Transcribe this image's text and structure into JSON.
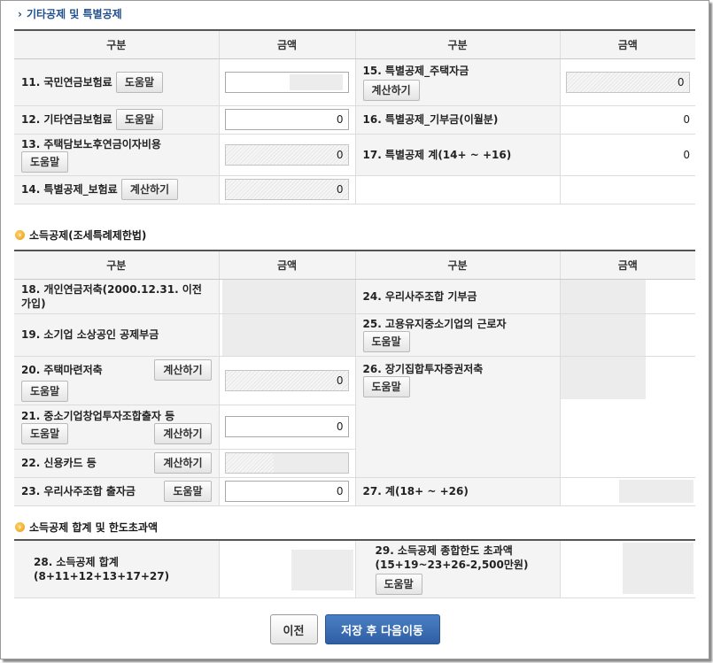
{
  "sections": {
    "other": "기타공제 및 특별공제",
    "income": "소득공제(조세특례제한법)",
    "total": "소득공제 합계 및 한도초과액"
  },
  "headers": {
    "category": "구분",
    "amount": "금액"
  },
  "buttons": {
    "help": "도움말",
    "calc": "계산하기",
    "prev": "이전",
    "save_next": "저장 후 다음이동"
  },
  "table1": {
    "r11": {
      "label": "11. 국민연금보험료"
    },
    "r12": {
      "label": "12. 기타연금보험료",
      "value": "0"
    },
    "r13": {
      "label": "13. 주택담보노후연금이자비용",
      "value": "0"
    },
    "r14": {
      "label": "14. 특별공제_보험료",
      "value": "0"
    },
    "r15": {
      "label": "15. 특별공제_주택자금",
      "value": "0"
    },
    "r16": {
      "label": "16. 특별공제_기부금(이월분)",
      "value": "0"
    },
    "r17": {
      "label": "17. 특별공제 계(14+ ~ +16)",
      "value": "0"
    }
  },
  "table2": {
    "r18": {
      "label": "18. 개인연금저축(2000.12.31. 이전 가입)"
    },
    "r19": {
      "label": "19. 소기업 소상공인 공제부금"
    },
    "r20": {
      "label": "20. 주택마련저축",
      "value": "0"
    },
    "r21": {
      "label": "21. 중소기업창업투자조합출자 등",
      "value": "0"
    },
    "r22": {
      "label": "22. 신용카드 등"
    },
    "r23": {
      "label": "23. 우리사주조합 출자금",
      "value": "0"
    },
    "r24": {
      "label": "24. 우리사주조합 기부금"
    },
    "r25": {
      "label": "25. 고용유지중소기업의 근로자"
    },
    "r26": {
      "label": "26. 장기집합투자증권저축"
    },
    "r27": {
      "label": "27. 계(18+ ~ +26)"
    }
  },
  "table3": {
    "r28": {
      "label": "28. 소득공제 합계(8+11+12+13+17+27)"
    },
    "r29": {
      "label": "29. 소득공제 종합한도 초과액(15+19~23+26-2,500만원)"
    }
  }
}
